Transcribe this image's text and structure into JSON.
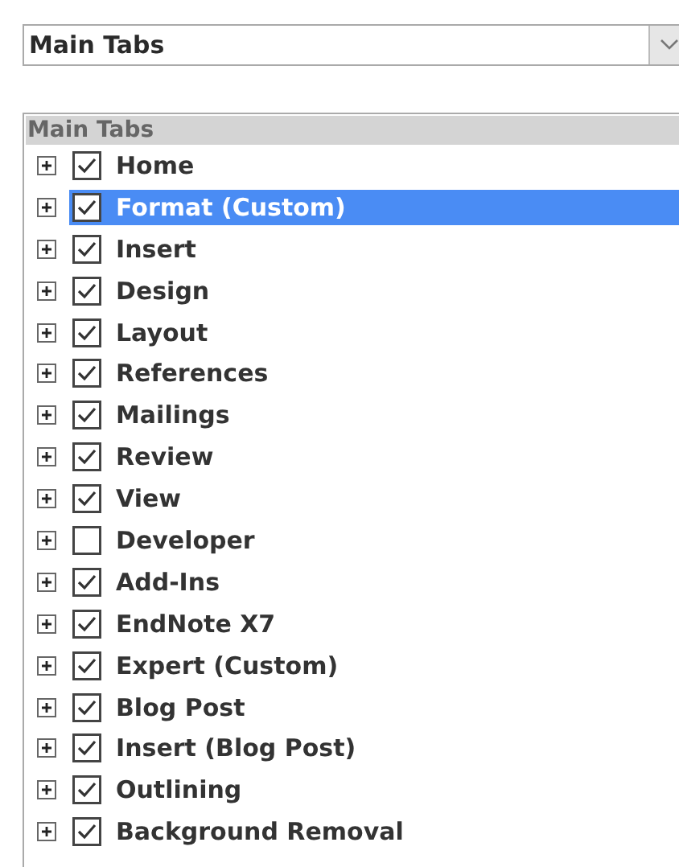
{
  "dropdown": {
    "value": "Main Tabs"
  },
  "tree": {
    "header": "Main Tabs",
    "items": [
      {
        "label": "Home",
        "checked": true,
        "selected": false
      },
      {
        "label": "Format (Custom)",
        "checked": true,
        "selected": true
      },
      {
        "label": "Insert",
        "checked": true,
        "selected": false
      },
      {
        "label": "Design",
        "checked": true,
        "selected": false
      },
      {
        "label": "Layout",
        "checked": true,
        "selected": false
      },
      {
        "label": "References",
        "checked": true,
        "selected": false
      },
      {
        "label": "Mailings",
        "checked": true,
        "selected": false
      },
      {
        "label": "Review",
        "checked": true,
        "selected": false
      },
      {
        "label": "View",
        "checked": true,
        "selected": false
      },
      {
        "label": "Developer",
        "checked": false,
        "selected": false
      },
      {
        "label": "Add-Ins",
        "checked": true,
        "selected": false
      },
      {
        "label": "EndNote X7",
        "checked": true,
        "selected": false
      },
      {
        "label": "Expert (Custom)",
        "checked": true,
        "selected": false
      },
      {
        "label": "Blog Post",
        "checked": true,
        "selected": false
      },
      {
        "label": "Insert (Blog Post)",
        "checked": true,
        "selected": false
      },
      {
        "label": "Outlining",
        "checked": true,
        "selected": false
      },
      {
        "label": "Background Removal",
        "checked": true,
        "selected": false
      }
    ]
  }
}
